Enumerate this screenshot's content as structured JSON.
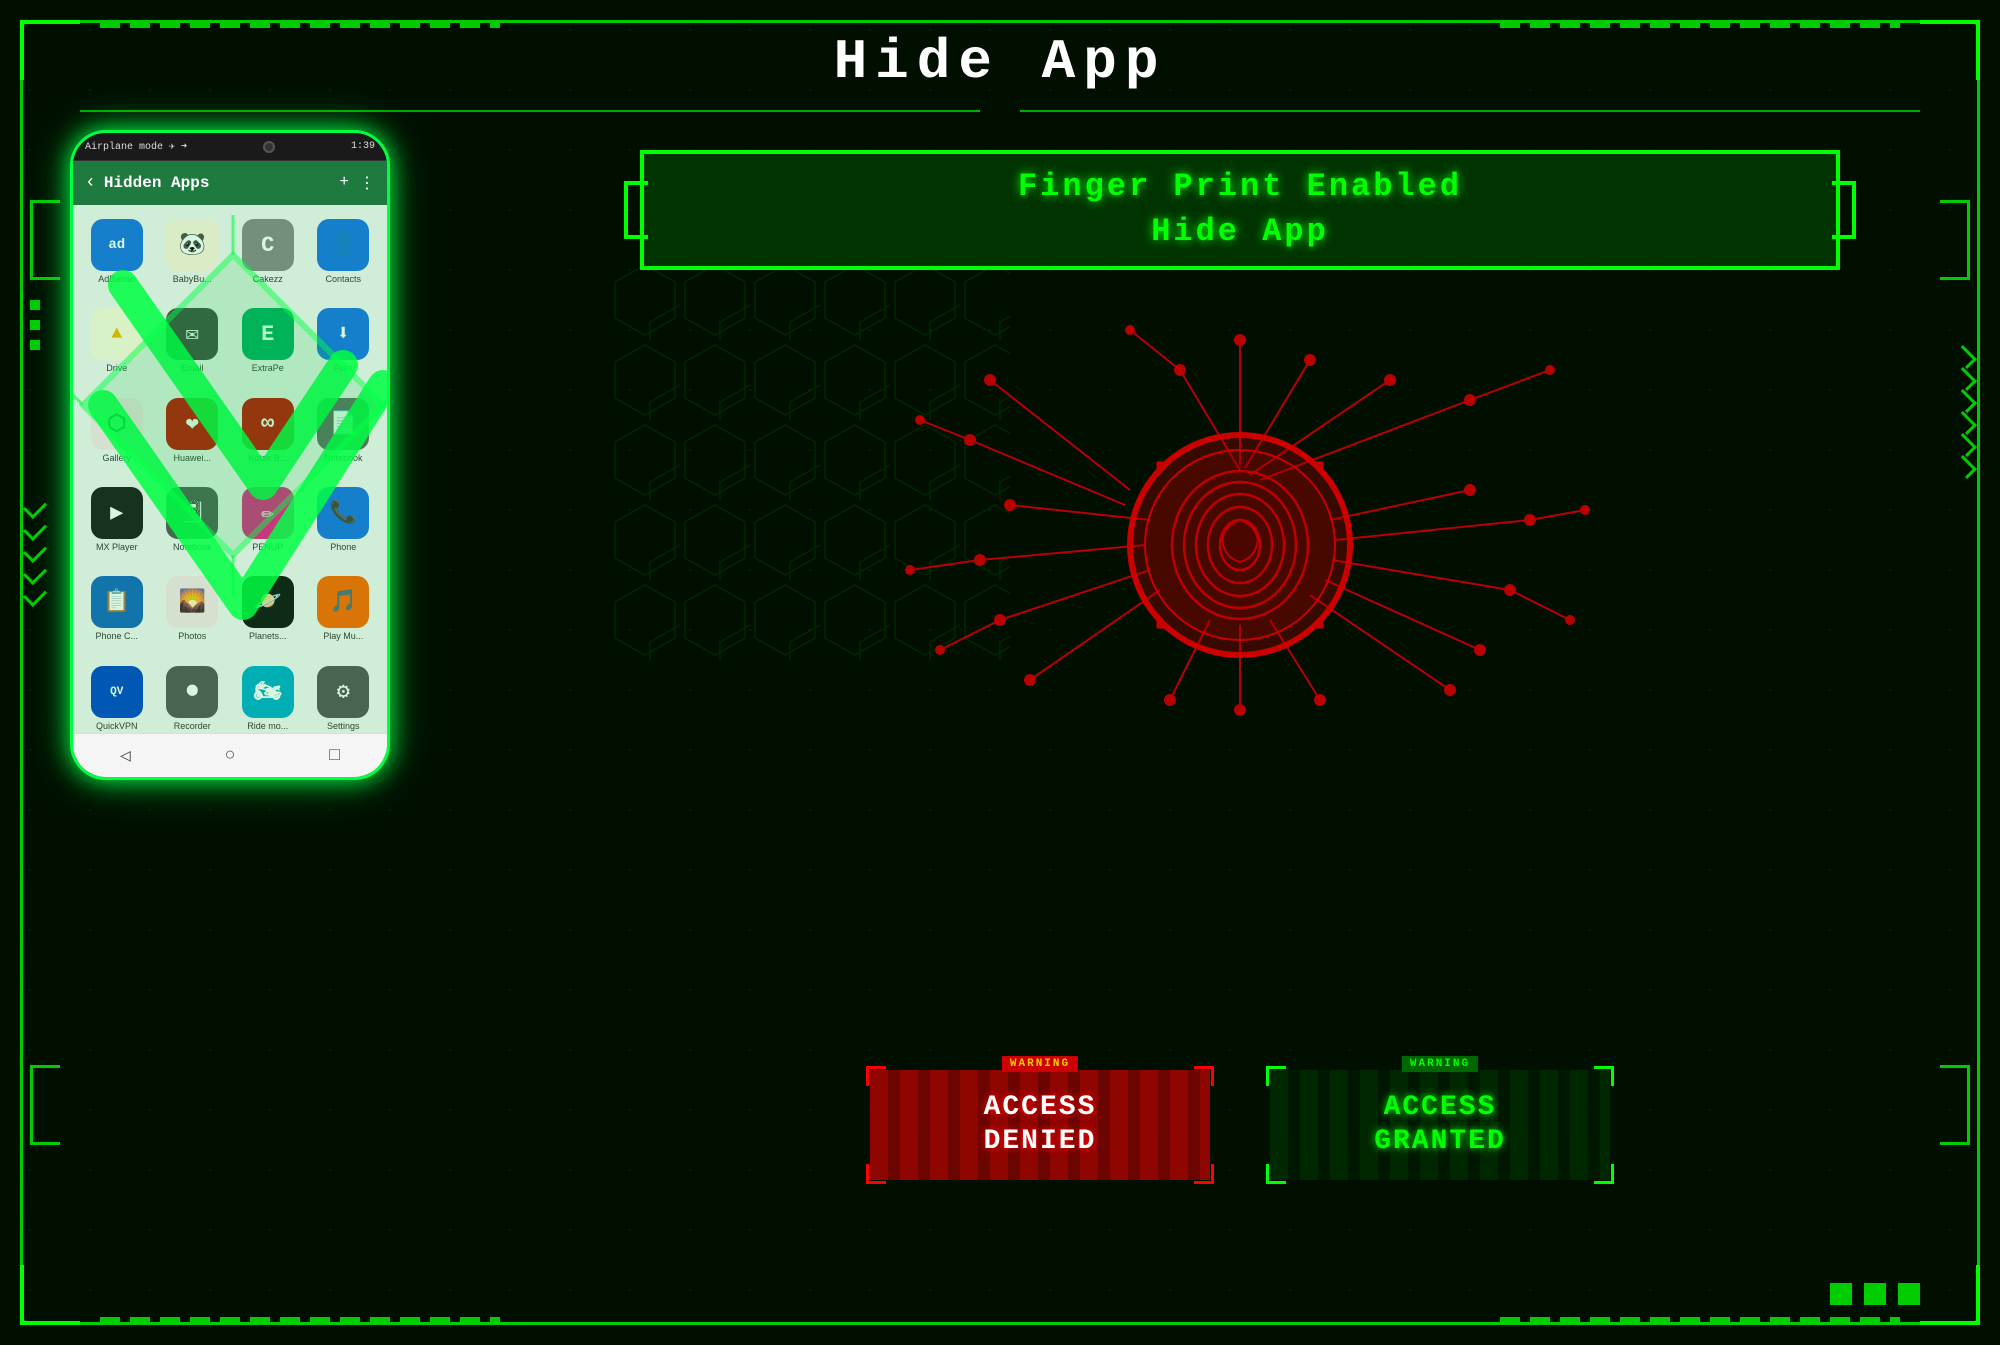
{
  "title": "Hide App",
  "colors": {
    "green": "#00ff00",
    "darkGreen": "#003300",
    "red": "#cc0000",
    "white": "#ffffff",
    "bg": "#010f01"
  },
  "fingerprint_label": {
    "line1": "Finger Print Enabled",
    "line2": "Hide App"
  },
  "access_denied": {
    "warning": "WARNING",
    "text": "ACCESS\nDENIED"
  },
  "access_granted": {
    "warning": "WARNING",
    "text": "ACCESS\nGRANTED"
  },
  "phone": {
    "status_left": "Airplane mode ✈ ➜",
    "status_right": "1:39",
    "toolbar_title": "Hidden Apps",
    "apps": [
      {
        "name": "AdBanao",
        "color": "#1a73e8",
        "icon": "ad"
      },
      {
        "name": "BabyBu...",
        "color": "#e8a000",
        "icon": "🐼"
      },
      {
        "name": "Cakezz",
        "color": "#888",
        "icon": "C"
      },
      {
        "name": "Contacts",
        "color": "#1a73e8",
        "icon": "👤"
      },
      {
        "name": "Drive",
        "color": "#f4b400",
        "icon": "▲"
      },
      {
        "name": "Email",
        "color": "#555",
        "icon": "✉"
      },
      {
        "name": "ExtraPe",
        "color": "#00aa66",
        "icon": "E"
      },
      {
        "name": "Files",
        "color": "#1a73e8",
        "icon": "⬇"
      },
      {
        "name": "Gallery",
        "color": "#e91e8c",
        "icon": "⬡"
      },
      {
        "name": "Huawei...",
        "color": "#cc0000",
        "icon": "❤"
      },
      {
        "name": "Kotak B...",
        "color": "#cc0000",
        "icon": "∞"
      },
      {
        "name": "Notebook",
        "color": "#555",
        "icon": "📄"
      },
      {
        "name": "MX Player",
        "color": "#1a1a1a",
        "icon": "▶"
      },
      {
        "name": "Notebook",
        "color": "#555",
        "icon": "📓"
      },
      {
        "name": "PENUP",
        "color": "#e91e8c",
        "icon": "✏"
      },
      {
        "name": "Phone",
        "color": "#1a73e8",
        "icon": "📞"
      },
      {
        "name": "Phone C...",
        "color": "#1a73e8",
        "icon": "📋"
      },
      {
        "name": "Photos",
        "color": "#e91e8c",
        "icon": "🌄"
      },
      {
        "name": "Planets...",
        "color": "#222",
        "icon": "🪐"
      },
      {
        "name": "Play Mu...",
        "color": "#ff6600",
        "icon": "🎵"
      },
      {
        "name": "QuickVPN",
        "color": "#0044cc",
        "icon": "QV"
      },
      {
        "name": "Recorder",
        "color": "#555",
        "icon": "⏺"
      },
      {
        "name": "Ride mo...",
        "color": "#00aacc",
        "icon": "🏍"
      },
      {
        "name": "Settings",
        "color": "#555",
        "icon": "⚙"
      }
    ]
  }
}
